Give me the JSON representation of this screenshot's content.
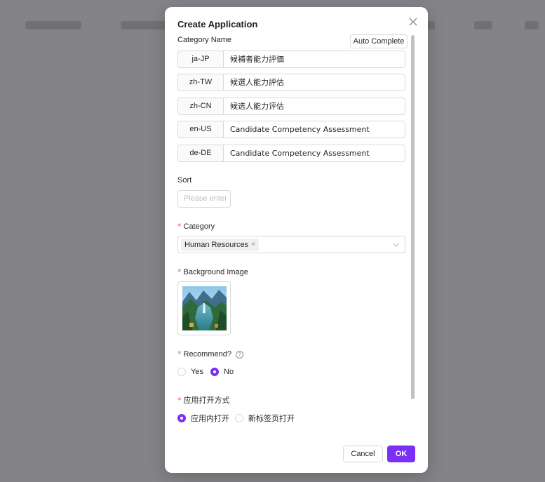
{
  "modal": {
    "title": "Create Application",
    "close_icon": "close-icon"
  },
  "category_name": {
    "label": "Category Name",
    "auto_complete_label": "Auto Complete",
    "translations": [
      {
        "code": "ja-JP",
        "value": "候補者能力評価"
      },
      {
        "code": "zh-TW",
        "value": "候選人能力評估"
      },
      {
        "code": "zh-CN",
        "value": "候选人能力评估"
      },
      {
        "code": "en-US",
        "value": "Candidate Competency Assessment"
      },
      {
        "code": "de-DE",
        "value": "Candidate Competency Assessment"
      }
    ]
  },
  "sort": {
    "label": "Sort",
    "placeholder": "Please enter",
    "value": ""
  },
  "category": {
    "required_mark": "*",
    "label": "Category",
    "selected_tag": "Human Resources",
    "tag_close": "×"
  },
  "background_image": {
    "required_mark": "*",
    "label": "Background Image",
    "image_icon": "landscape-thumbnail"
  },
  "recommend": {
    "required_mark": "*",
    "label": "Recommend?",
    "help_glyph": "?",
    "options": [
      {
        "label": "Yes",
        "selected": false
      },
      {
        "label": "No",
        "selected": true
      }
    ]
  },
  "open_mode": {
    "required_mark": "*",
    "label": "应用打开方式",
    "options": [
      {
        "label": "应用内打开",
        "selected": true
      },
      {
        "label": "新标签页打开",
        "selected": false
      }
    ]
  },
  "footer": {
    "cancel_label": "Cancel",
    "ok_label": "OK"
  },
  "colors": {
    "primary": "#7b2ff7",
    "required": "#ff4d4f",
    "border": "#d9d9d9"
  }
}
